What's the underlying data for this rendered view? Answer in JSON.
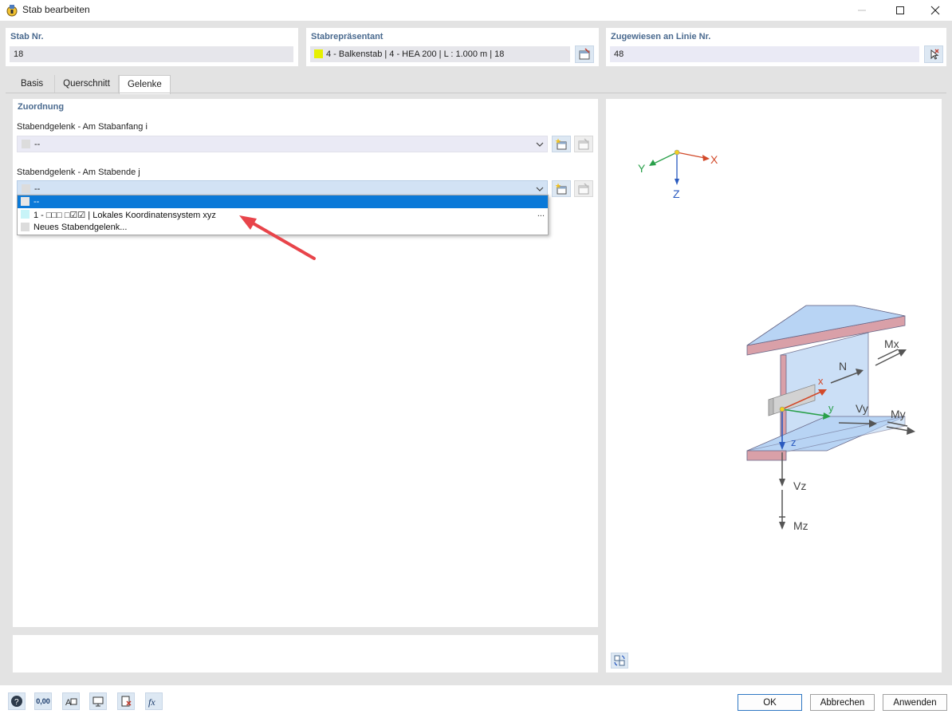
{
  "window": {
    "title": "Stab bearbeiten"
  },
  "header": {
    "stab_nr_label": "Stab Nr.",
    "stab_nr_value": "18",
    "representative_label": "Stabrepräsentant",
    "representative_value": "4 - Balkenstab | 4 - HEA 200 | L : 1.000 m | 18",
    "representative_color": "#e6f000",
    "line_label": "Zugewiesen an Linie Nr.",
    "line_value": "48"
  },
  "tabs": [
    {
      "label": "Basis"
    },
    {
      "label": "Querschnitt"
    },
    {
      "label": "Gelenke"
    }
  ],
  "zuordnung": {
    "title": "Zuordnung",
    "start_label": "Stabendgelenk - Am Stabanfang i",
    "start_value": "--",
    "end_label": "Stabendgelenk - Am Stabende j",
    "end_value": "--"
  },
  "dropdown": {
    "items": [
      {
        "label": "--",
        "swatch": "#e6e6e6"
      },
      {
        "label": "1 - □□□ □☑☑ | Lokales Koordinatensystem xyz",
        "swatch": "#c8f4f8"
      },
      {
        "label": "Neues Stabendgelenk...",
        "swatch": "#dcdcdc"
      }
    ],
    "more": "..."
  },
  "diagram": {
    "global_axes": {
      "x": "X",
      "y": "Y",
      "z": "Z"
    },
    "local_axes": {
      "x": "x",
      "y": "y",
      "z": "z"
    },
    "labels": {
      "N": "N",
      "Mx": "Mx",
      "Vy": "Vy",
      "My": "My",
      "Vz": "Vz",
      "Mz": "Mz"
    }
  },
  "buttons": {
    "ok": "OK",
    "cancel": "Abbrechen",
    "apply": "Anwenden"
  },
  "toolbar": {
    "values_label": "0,00"
  },
  "colors": {
    "accent": "#0a79d8",
    "heading": "#4a6a8f",
    "section_fill": "#b8d4f4",
    "section_edge": "#d9a0a8"
  }
}
